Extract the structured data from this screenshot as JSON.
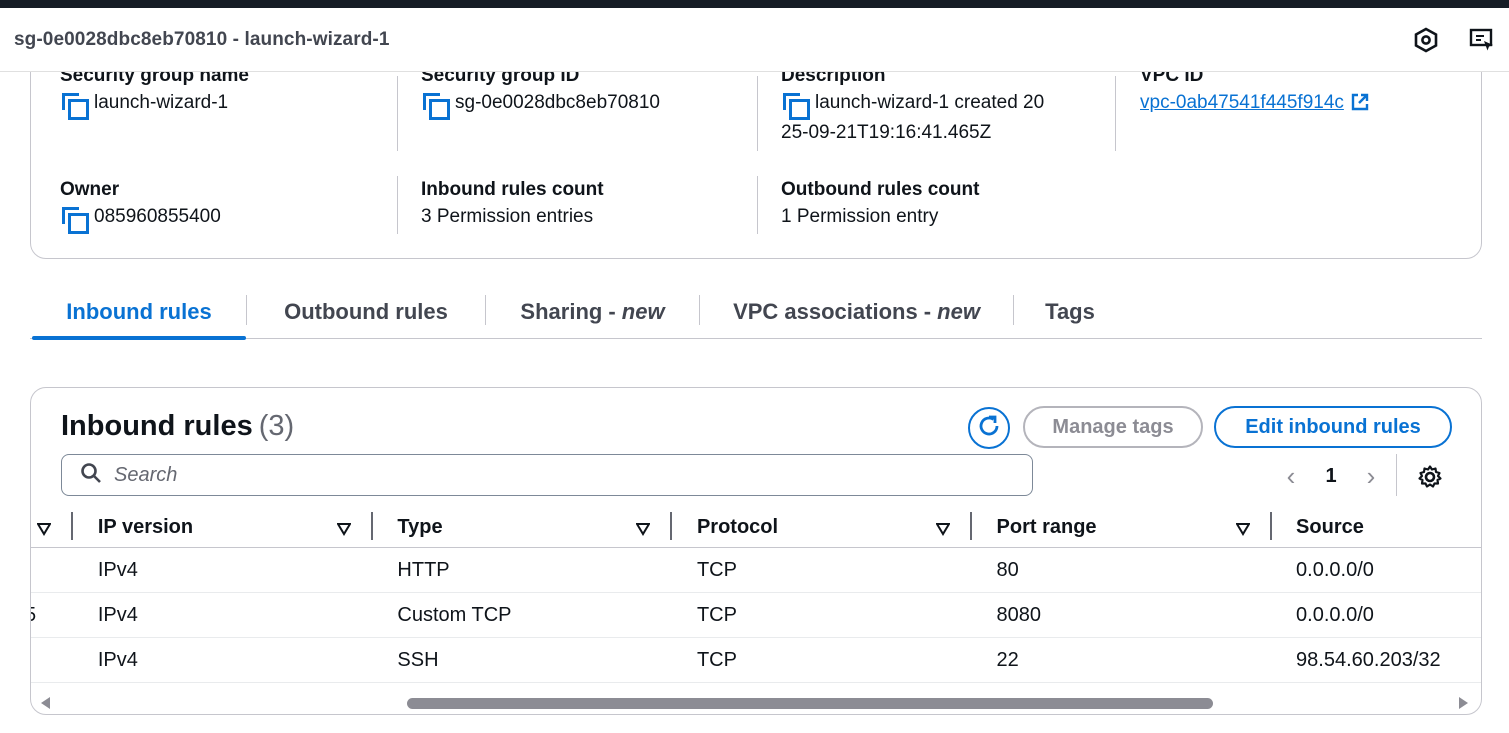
{
  "titlebar": {
    "title": "sg-0e0028dbc8eb70810 - launch-wizard-1",
    "icons": [
      "hexagon-icon",
      "screen-share-icon"
    ]
  },
  "details": {
    "sg_name": {
      "label": "Security group name",
      "value": "launch-wizard-1"
    },
    "sg_id": {
      "label": "Security group ID",
      "value": "sg-0e0028dbc8eb70810"
    },
    "description": {
      "label": "Description",
      "value_line1": "launch-wizard-1 created 20",
      "value_line2": "25-09-21T19:16:41.465Z"
    },
    "vpc_id": {
      "label": "VPC ID",
      "value": "vpc-0ab47541f445f914c"
    },
    "owner": {
      "label": "Owner",
      "value": "085960855400"
    },
    "inbound_count": {
      "label": "Inbound rules count",
      "value": "3 Permission entries"
    },
    "outbound_count": {
      "label": "Outbound rules count",
      "value": "1 Permission entry"
    }
  },
  "tabs": [
    {
      "label": "Inbound rules",
      "suffix": ""
    },
    {
      "label": "Outbound rules",
      "suffix": ""
    },
    {
      "label": "Sharing - ",
      "suffix": "new"
    },
    {
      "label": "VPC associations - ",
      "suffix": "new"
    },
    {
      "label": "Tags",
      "suffix": ""
    }
  ],
  "rules": {
    "title": "Inbound rules",
    "count": "(3)",
    "manage_tags": "Manage tags",
    "edit_rules": "Edit inbound rules",
    "search_placeholder": "Search",
    "page": "1",
    "columns": [
      "IP version",
      "Type",
      "Protocol",
      "Port range",
      "Source"
    ],
    "rows": [
      {
        "cut": "",
        "ip": "IPv4",
        "type": "HTTP",
        "protocol": "TCP",
        "port": "80",
        "source": "0.0.0.0/0"
      },
      {
        "cut": "5",
        "ip": "IPv4",
        "type": "Custom TCP",
        "protocol": "TCP",
        "port": "8080",
        "source": "0.0.0.0/0"
      },
      {
        "cut": "",
        "ip": "IPv4",
        "type": "SSH",
        "protocol": "TCP",
        "port": "22",
        "source": "98.54.60.203/32"
      }
    ]
  },
  "colors": {
    "accent": "#0972d3",
    "text": "#0f141a",
    "muted": "#656871",
    "border": "#c6c6cd"
  }
}
